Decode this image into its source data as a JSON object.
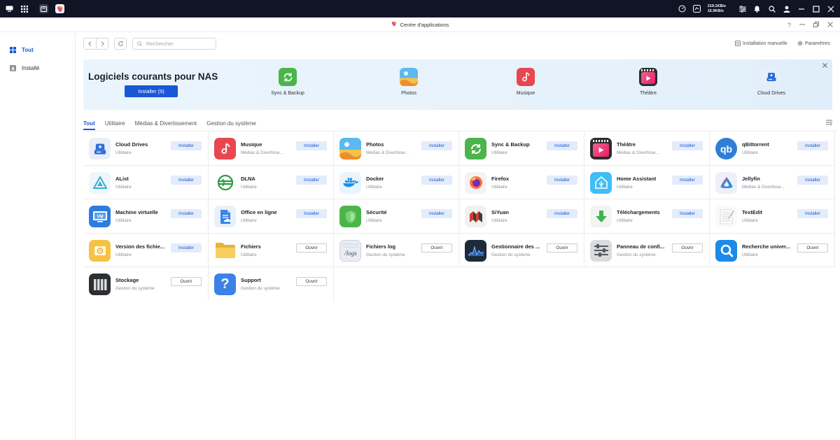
{
  "taskbar": {
    "upload": "219.1KB/s",
    "download": "15.9KB/s"
  },
  "window": {
    "title": "Centre d'applications"
  },
  "sidebar": {
    "items": [
      {
        "label": "Tout"
      },
      {
        "label": "Installé"
      }
    ]
  },
  "toolbar": {
    "search_placeholder": "Rechercher",
    "manual_install": "Installation manuelle",
    "settings": "Paramètres"
  },
  "banner": {
    "title": "Logiciels courants pour NAS",
    "install_label": "Installer (5)",
    "apps": [
      {
        "label": "Sync & Backup"
      },
      {
        "label": "Photos"
      },
      {
        "label": "Musique"
      },
      {
        "label": "Théâtre"
      },
      {
        "label": "Cloud Drives"
      }
    ]
  },
  "tabs": [
    {
      "label": "Tout"
    },
    {
      "label": "Utilitaire"
    },
    {
      "label": "Médias & Divertissement"
    },
    {
      "label": "Gestion du système"
    }
  ],
  "apps": [
    {
      "name": "Cloud Drives",
      "category": "Utilitaire",
      "action": "Installer",
      "icon": "cloud-drives-icon"
    },
    {
      "name": "Musique",
      "category": "Médias & Divertisse...",
      "action": "Installer",
      "icon": "music-icon"
    },
    {
      "name": "Photos",
      "category": "Médias & Divertisse...",
      "action": "Installer",
      "icon": "photos-icon"
    },
    {
      "name": "Sync & Backup",
      "category": "Utilitaire",
      "action": "Installer",
      "icon": "sync-backup-icon"
    },
    {
      "name": "Théâtre",
      "category": "Médias & Divertisse...",
      "action": "Installer",
      "icon": "theater-icon"
    },
    {
      "name": "qBittorrent",
      "category": "Utilitaire",
      "action": "Installer",
      "icon": "qbittorrent-icon"
    },
    {
      "name": "AList",
      "category": "Utilitaire",
      "action": "Installer",
      "icon": "alist-icon"
    },
    {
      "name": "DLNA",
      "category": "Utilitaire",
      "action": "Installer",
      "icon": "dlna-icon"
    },
    {
      "name": "Docker",
      "category": "Utilitaire",
      "action": "Installer",
      "icon": "docker-icon"
    },
    {
      "name": "Firefox",
      "category": "Utilitaire",
      "action": "Installer",
      "icon": "firefox-icon"
    },
    {
      "name": "Home Assistant",
      "category": "Utilitaire",
      "action": "Installer",
      "icon": "home-assistant-icon"
    },
    {
      "name": "Jellyfin",
      "category": "Médias & Divertisse...",
      "action": "Installer",
      "icon": "jellyfin-icon"
    },
    {
      "name": "Machine virtuelle",
      "category": "Utilitaire",
      "action": "Installer",
      "icon": "virtual-machine-icon"
    },
    {
      "name": "Office en ligne",
      "category": "Utilitaire",
      "action": "Installer",
      "icon": "office-online-icon"
    },
    {
      "name": "Sécurité",
      "category": "Utilitaire",
      "action": "Installer",
      "icon": "security-shield-icon"
    },
    {
      "name": "SiYuan",
      "category": "Utilitaire",
      "action": "Installer",
      "icon": "siyuan-icon"
    },
    {
      "name": "Téléchargements",
      "category": "Utilitaire",
      "action": "Installer",
      "icon": "download-arrow-icon"
    },
    {
      "name": "TextEdit",
      "category": "Utilitaire",
      "action": "Installer",
      "icon": "textedit-icon"
    },
    {
      "name": "Version des fichie...",
      "category": "Utilitaire",
      "action": "Installer",
      "icon": "file-version-icon"
    },
    {
      "name": "Fichiers",
      "category": "Utilitaire",
      "action": "Ouvrir",
      "icon": "folder-icon"
    },
    {
      "name": "Fichiers log",
      "category": "Gestion du système",
      "action": "Ouvrir",
      "icon": "logs-icon"
    },
    {
      "name": "Gestionnaire des ...",
      "category": "Gestion du système",
      "action": "Ouvrir",
      "icon": "resource-monitor-icon"
    },
    {
      "name": "Panneau de confi...",
      "category": "Gestion du système",
      "action": "Ouvrir",
      "icon": "control-panel-icon"
    },
    {
      "name": "Recherche univer...",
      "category": "Utilitaire",
      "action": "Ouvrir",
      "icon": "universal-search-icon"
    },
    {
      "name": "Stockage",
      "category": "Gestion du système",
      "action": "Ouvrir",
      "icon": "storage-icon"
    },
    {
      "name": "Support",
      "category": "Gestion du système",
      "action": "Ouvrir",
      "icon": "support-question-icon"
    }
  ]
}
